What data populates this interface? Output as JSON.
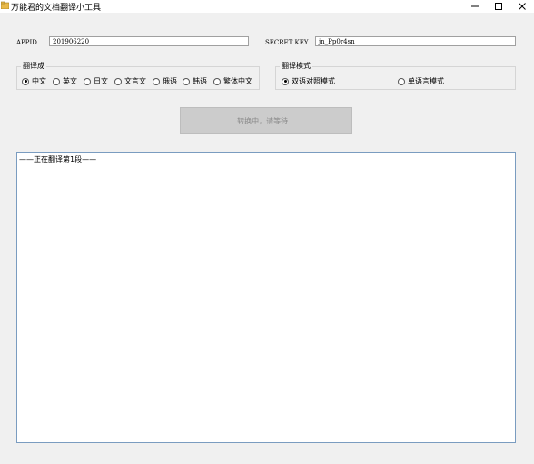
{
  "window": {
    "title": "万能君的文档翻译小工具",
    "icon": "app-folder-icon",
    "controls": [
      "minimize-icon",
      "maximize-icon",
      "close-icon"
    ]
  },
  "credentials": {
    "appid_label": "APPID",
    "appid_value": "201906220",
    "secret_label": "SECRET KEY",
    "secret_value": "jn_Pp0r4sn"
  },
  "target_language": {
    "title": "翻译成",
    "options": [
      "中文",
      "英文",
      "日文",
      "文言文",
      "俄语",
      "韩语",
      "繁体中文"
    ],
    "selected": "中文"
  },
  "mode": {
    "title": "翻译模式",
    "options": [
      "双语对照模式",
      "单语言模式"
    ],
    "selected": "双语对照模式"
  },
  "action": {
    "button_label": "转换中，请等待..."
  },
  "output": {
    "text": "——正在翻译第1段——"
  },
  "colors": {
    "background": "#f0f0f0",
    "titlebar": "#ffffff",
    "output_border": "#7a9cc0",
    "disabled_button": "#cccccc",
    "disabled_text": "#8a8a8a"
  }
}
